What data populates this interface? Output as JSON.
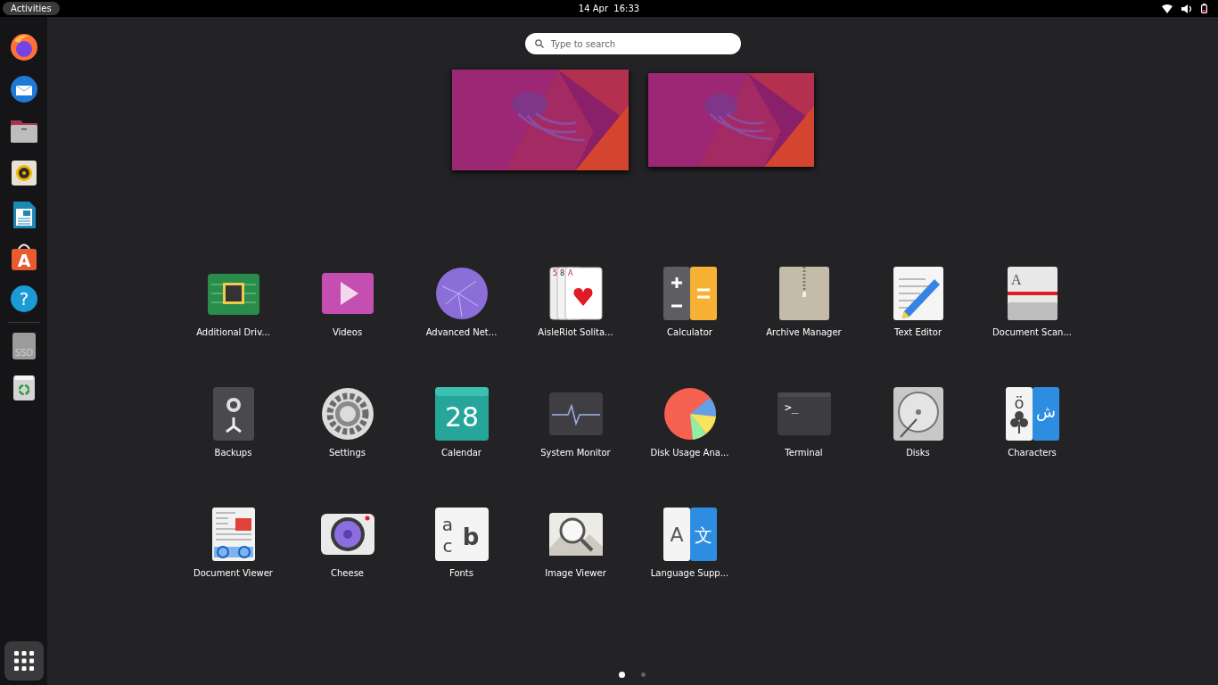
{
  "top_bar": {
    "activities": "Activities",
    "clock": "14 Apr  16:33"
  },
  "search": {
    "placeholder": "Type to search"
  },
  "workspaces": [
    {
      "kind": "picture",
      "selected": true
    },
    {
      "kind": "picture",
      "selected": false
    }
  ],
  "dock": {
    "items": [
      {
        "kind": "firefox"
      },
      {
        "kind": "mail"
      },
      {
        "kind": "folder"
      },
      {
        "kind": "speaker"
      },
      {
        "kind": "writer"
      },
      {
        "kind": "store",
        "glyph": "A"
      },
      {
        "kind": "help",
        "glyph": "?"
      },
      {
        "kind": "separator"
      },
      {
        "kind": "drive",
        "glyph": "SSD"
      },
      {
        "kind": "trash"
      }
    ]
  },
  "apps": [
    {
      "name": "Additional Driv...",
      "kind": "chip"
    },
    {
      "name": "Videos",
      "kind": "video"
    },
    {
      "name": "Advanced Net...",
      "kind": "globe"
    },
    {
      "name": "AisleRiot Solita...",
      "kind": "cards",
      "glyphs": [
        "5",
        "8",
        "A"
      ]
    },
    {
      "name": "Calculator",
      "kind": "calculator"
    },
    {
      "name": "Archive Manager",
      "kind": "archive"
    },
    {
      "name": "Text Editor",
      "kind": "editor"
    },
    {
      "name": "Document Scan...",
      "kind": "scanner",
      "glyphs": [
        "A"
      ]
    },
    {
      "name": "Backups",
      "kind": "backup"
    },
    {
      "name": "Settings",
      "kind": "settings"
    },
    {
      "name": "Calendar",
      "kind": "calendar",
      "glyphs": [
        "28"
      ]
    },
    {
      "name": "System Monitor",
      "kind": "monitor"
    },
    {
      "name": "Disk Usage Ana...",
      "kind": "pie"
    },
    {
      "name": "Terminal",
      "kind": "terminal",
      "glyphs": [
        ">_"
      ]
    },
    {
      "name": "Disks",
      "kind": "disk"
    },
    {
      "name": "Characters",
      "kind": "characters",
      "glyphs": [
        "ö",
        "ش"
      ]
    },
    {
      "name": "Document Viewer",
      "kind": "docviewer"
    },
    {
      "name": "Cheese",
      "kind": "camera"
    },
    {
      "name": "Fonts",
      "kind": "fonts",
      "glyphs": [
        "a",
        "c",
        "b"
      ]
    },
    {
      "name": "Image Viewer",
      "kind": "imageviewer"
    },
    {
      "name": "Language Supp...",
      "kind": "language",
      "glyphs": [
        "A",
        "文"
      ]
    }
  ],
  "pages": [
    {
      "selected": true
    },
    {
      "selected": false
    }
  ]
}
